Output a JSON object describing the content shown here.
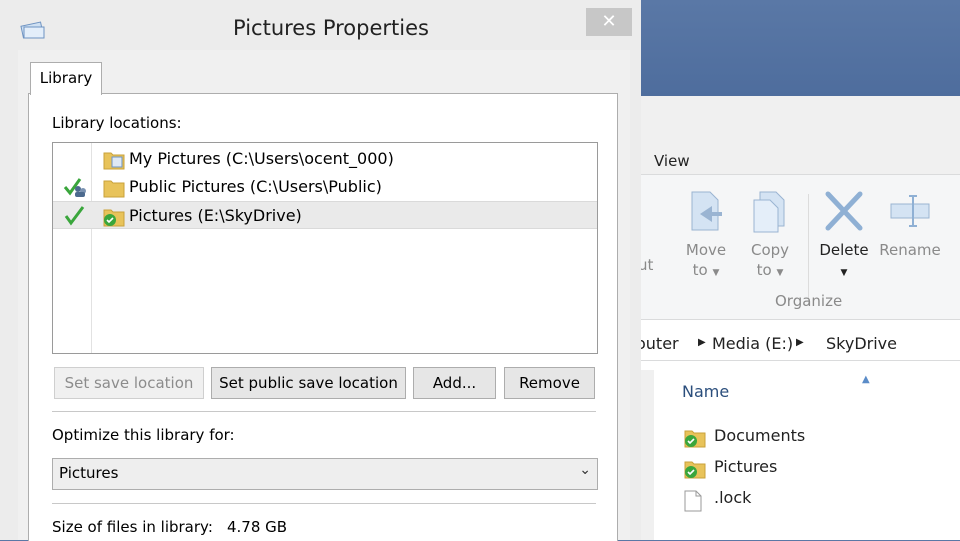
{
  "dialog": {
    "title": "Pictures Properties",
    "close_glyph": "✕",
    "tab_label": "Library",
    "locations_label": "Library locations:",
    "locations": [
      {
        "text": "My Pictures (C:\\Users\\ocent_000)",
        "status_icon": "none",
        "folder_icon": "library-folder-icon",
        "selected": false
      },
      {
        "text": "Public Pictures (C:\\Users\\Public)",
        "status_icon": "public-save-location-icon",
        "folder_icon": "folder-icon",
        "selected": false
      },
      {
        "text": "Pictures (E:\\SkyDrive)",
        "status_icon": "default-save-location-check-icon",
        "folder_icon": "synced-folder-icon",
        "selected": true
      }
    ],
    "buttons": {
      "set_save_location": "Set save location",
      "set_public_save_location": "Set public save location",
      "add": "Add...",
      "remove": "Remove"
    },
    "optimize_label": "Optimize this library for:",
    "optimize_value": "Pictures",
    "size_label": "Size of files in library:",
    "size_value": "4.78 GB"
  },
  "explorer": {
    "ribbon_tab": "View",
    "cut_fragment": "ut",
    "buttons": [
      {
        "line1": "Move",
        "line2": "to"
      },
      {
        "line1": "Copy",
        "line2": "to"
      },
      {
        "line1": "Delete",
        "line2": ""
      },
      {
        "line1": "Rename",
        "line2": ""
      }
    ],
    "group_label": "Organize",
    "breadcrumb": [
      "outer",
      "Media (E:)",
      "SkyDrive"
    ],
    "column_name": "Name",
    "files": [
      {
        "name": "Documents",
        "icon": "synced-folder-icon"
      },
      {
        "name": "Pictures",
        "icon": "synced-folder-icon"
      },
      {
        "name": ".lock",
        "icon": "file-icon"
      }
    ]
  },
  "colors": {
    "desktop": "#3f5f92",
    "dialog_bg": "#f0f0f0",
    "close_button": "#c7c7c7",
    "check_green": "#3aa63c",
    "folder_yellow": "#e8c35a"
  }
}
